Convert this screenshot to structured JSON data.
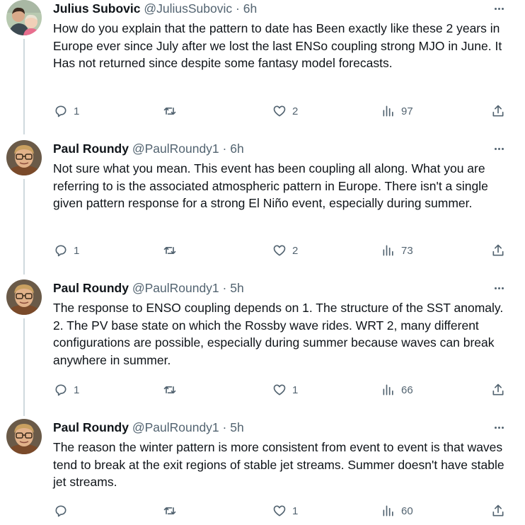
{
  "tweets": [
    {
      "name": "Julius Subovic",
      "handle": "@JuliusSubovic",
      "separator": "·",
      "time": "6h",
      "text": "How do you explain that the pattern to date has Been exactly like these 2 years in Europe ever since July after we lost the last ENSo coupling strong MJO in June. It Has not returned since despite some fantasy model forecasts.",
      "replies": "1",
      "retweets": "",
      "likes": "2",
      "views": "97",
      "avatar": "family-photo"
    },
    {
      "name": "Paul Roundy",
      "handle": "@PaulRoundy1",
      "separator": "·",
      "time": "6h",
      "text": "Not sure what you mean. This event has been coupling all along. What you are referring to is the associated atmospheric pattern in Europe. There isn't a single given pattern response for a strong El Niño event, especially during summer.",
      "replies": "1",
      "retweets": "",
      "likes": "2",
      "views": "73",
      "avatar": "man-with-glasses"
    },
    {
      "name": "Paul Roundy",
      "handle": "@PaulRoundy1",
      "separator": "·",
      "time": "5h",
      "text": "The response to ENSO coupling depends on 1. The structure of the SST anomaly. 2. The PV base state on which the Rossby wave rides. WRT 2, many different configurations are possible, especially during summer because waves can break anywhere in summer.",
      "replies": "1",
      "retweets": "",
      "likes": "1",
      "views": "66",
      "avatar": "man-with-glasses"
    },
    {
      "name": "Paul Roundy",
      "handle": "@PaulRoundy1",
      "separator": "·",
      "time": "5h",
      "text": "The reason the winter pattern is more consistent from event to event is that waves tend to break at the exit regions of stable jet streams. Summer doesn't have stable jet streams.",
      "replies": "",
      "retweets": "",
      "likes": "1",
      "views": "60",
      "avatar": "man-with-glasses"
    }
  ],
  "icons": {
    "reply": "reply-icon",
    "retweet": "retweet-icon",
    "like": "heart-icon",
    "views": "views-icon",
    "share": "share-icon",
    "more": "more-icon"
  },
  "colors": {
    "text": "#0f1419",
    "secondary": "#536471",
    "thread_line": "#cfd9de"
  }
}
